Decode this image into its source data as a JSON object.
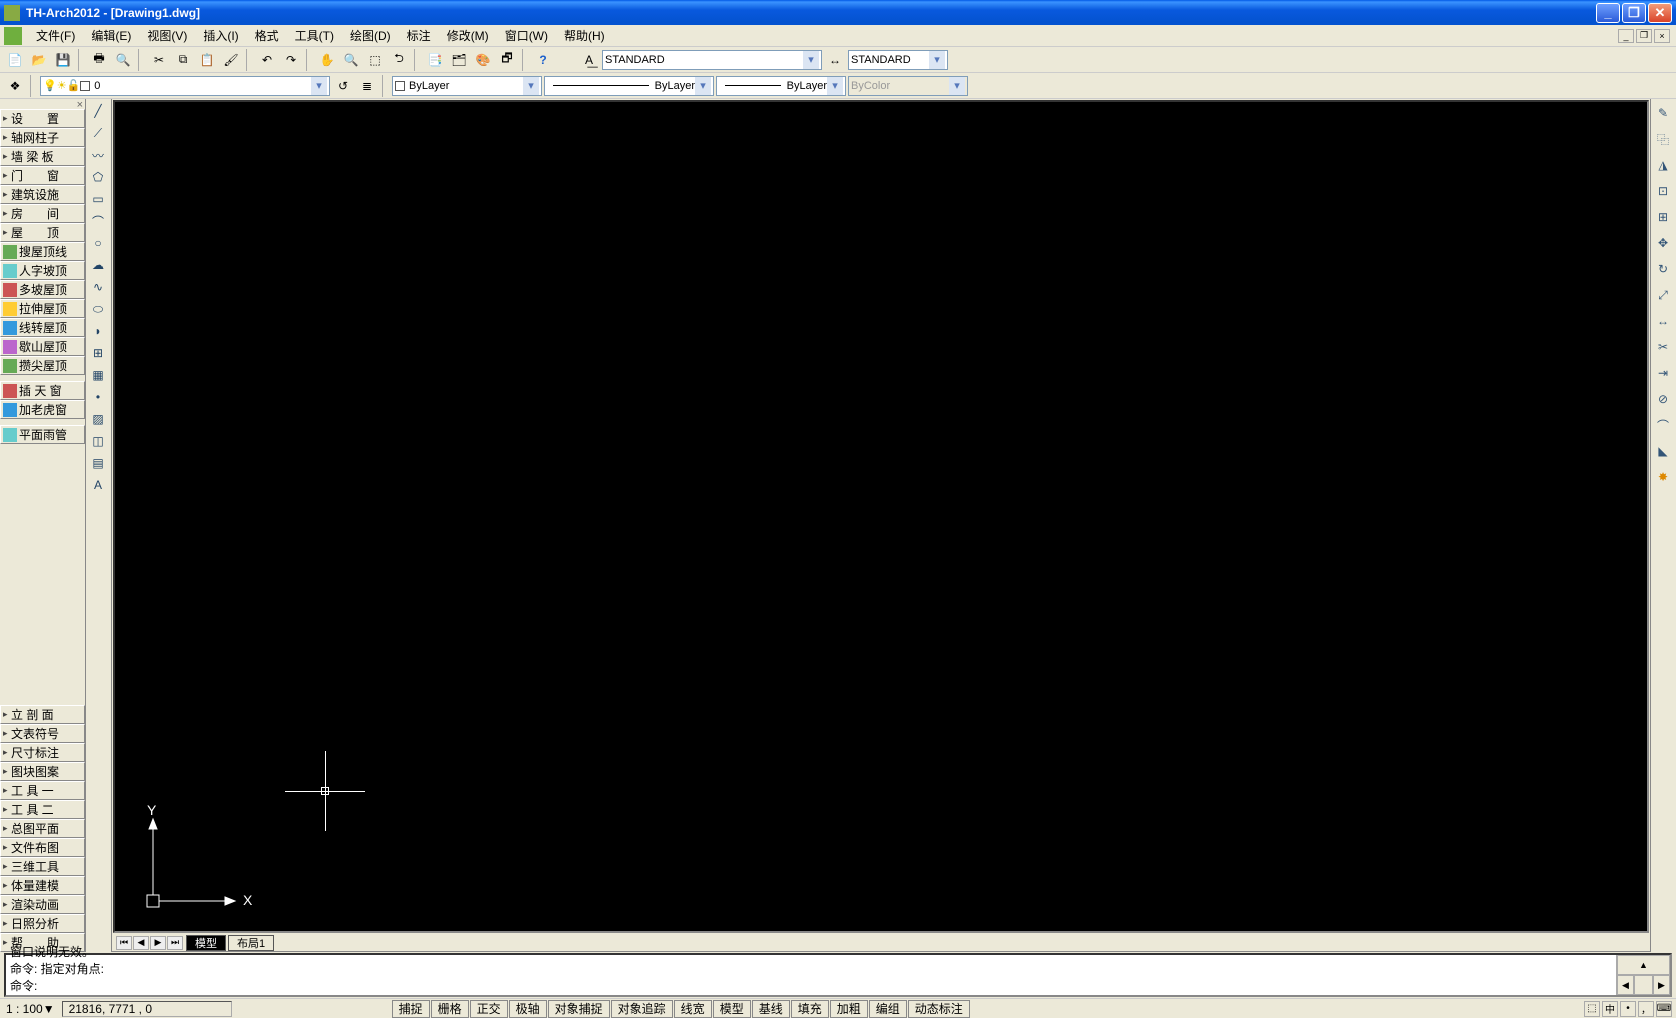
{
  "titlebar": {
    "text": "TH-Arch2012 - [Drawing1.dwg]"
  },
  "menu": {
    "items": [
      "文件(F)",
      "编辑(E)",
      "视图(V)",
      "插入(I)",
      "格式",
      "工具(T)",
      "绘图(D)",
      "标注",
      "修改(M)",
      "窗口(W)",
      "帮助(H)"
    ]
  },
  "layer_combo": {
    "value": "0"
  },
  "style_combo1": {
    "value": "STANDARD"
  },
  "style_combo2": {
    "value": "STANDARD"
  },
  "color_combo": {
    "value": "ByLayer"
  },
  "linetype_combo": {
    "value": "ByLayer"
  },
  "lineweight_combo": {
    "value": "ByLayer"
  },
  "plotstyle_combo": {
    "value": "ByColor"
  },
  "left_panel_top": [
    {
      "label": "设　　置",
      "icon": ""
    },
    {
      "label": "轴网柱子",
      "icon": ""
    },
    {
      "label": "墙 梁 板",
      "icon": ""
    },
    {
      "label": "门　　窗",
      "icon": ""
    },
    {
      "label": "建筑设施",
      "icon": ""
    },
    {
      "label": "房　　间",
      "icon": ""
    },
    {
      "label": "屋　　顶",
      "icon": ""
    }
  ],
  "left_panel_mid": [
    {
      "label": "搜屋顶线",
      "ic": "ic-grn"
    },
    {
      "label": "人字坡顶",
      "ic": "ic-cyn"
    },
    {
      "label": "多坡屋顶",
      "ic": "ic-red"
    },
    {
      "label": "拉伸屋顶",
      "ic": "ic-yel"
    },
    {
      "label": "线转屋顶",
      "ic": "ic-blue"
    },
    {
      "label": "歇山屋顶",
      "ic": "ic-mag"
    },
    {
      "label": "攒尖屋顶",
      "ic": "ic-grn"
    }
  ],
  "left_panel_mid2": [
    {
      "label": "插 天 窗",
      "ic": "ic-red"
    },
    {
      "label": "加老虎窗",
      "ic": "ic-blue"
    }
  ],
  "left_panel_mid3": [
    {
      "label": "平面雨管",
      "ic": "ic-cyn"
    }
  ],
  "left_panel_bottom": [
    "立 剖 面",
    "文表符号",
    "尺寸标注",
    "图块图案",
    "工 具 一",
    "工 具 二",
    "总图平面",
    "文件布图",
    "三维工具",
    "体量建模",
    "渲染动画",
    "日照分析",
    "帮　　助"
  ],
  "tabs": {
    "active": "模型",
    "inactive": "布局1"
  },
  "command": {
    "line1": "窗口说明无效。",
    "line2": "命令: 指定对角点:",
    "prompt": "命令:"
  },
  "statusbar": {
    "scale": "1 : 100▼",
    "coords": "21816, 7771 , 0",
    "buttons": [
      "捕捉",
      "栅格",
      "正交",
      "极轴",
      "对象捕捉",
      "对象追踪",
      "线宽",
      "模型",
      "基线",
      "填充",
      "加粗",
      "编组",
      "动态标注"
    ],
    "ime": "中"
  },
  "ucs_labels": {
    "x": "X",
    "y": "Y"
  }
}
